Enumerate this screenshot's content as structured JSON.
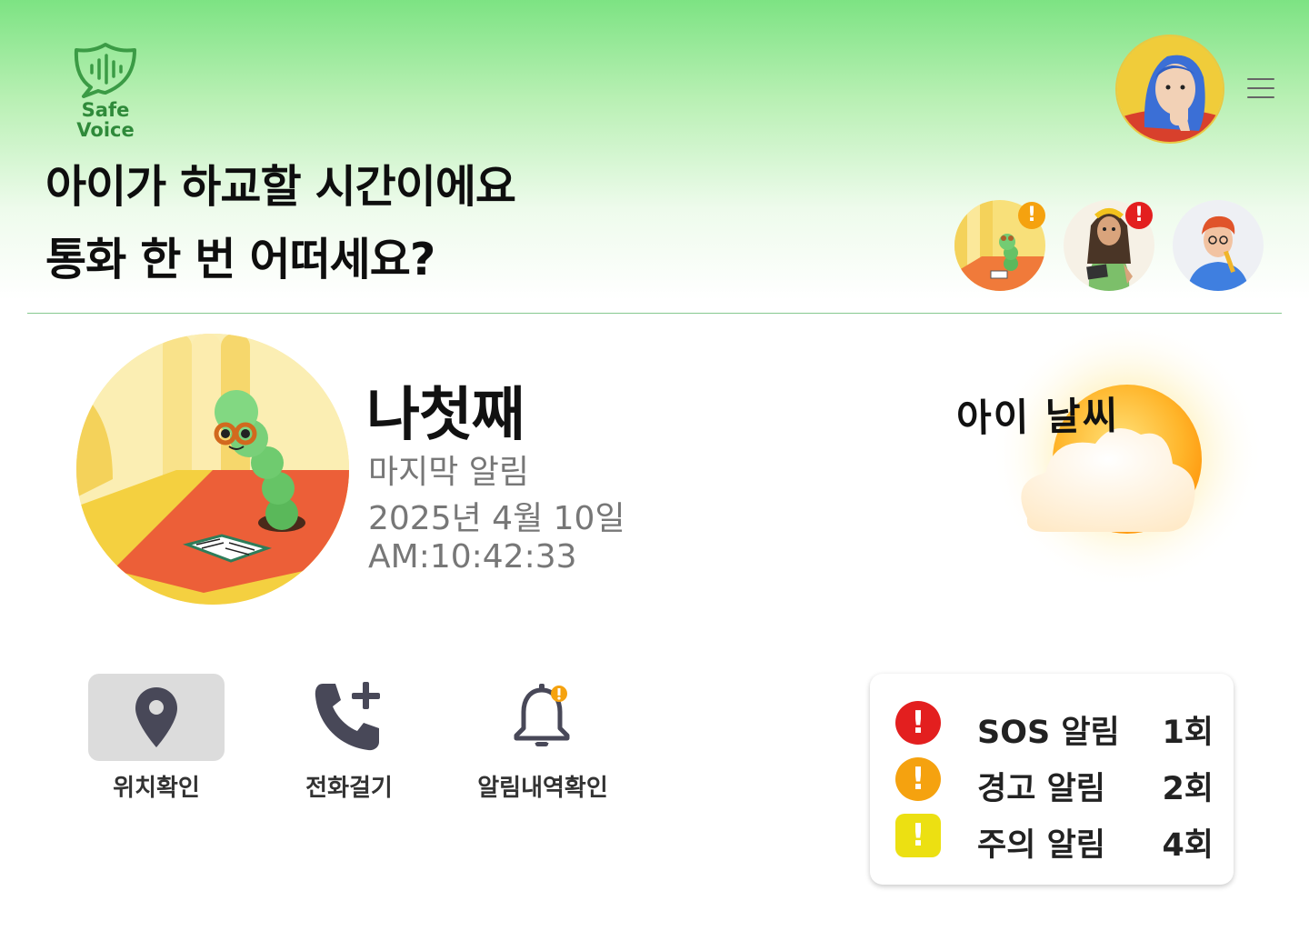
{
  "brand": {
    "line1": "Safe",
    "line2": "Voice",
    "color": "#2f8a3a"
  },
  "headline": {
    "line1": "아이가 하교할 시간이에요",
    "line2": "통화 한 번 어떠세요?"
  },
  "header": {
    "menu_icon": "hamburger-menu-icon",
    "profile_avatar": "user-avatar"
  },
  "children": [
    {
      "avatar": "caterpillar-avatar",
      "badge": "!",
      "badge_color": "#f5a20f"
    },
    {
      "avatar": "girl-laptop-avatar",
      "badge": "!",
      "badge_color": "#e31f1f"
    },
    {
      "avatar": "boy-pencil-avatar"
    }
  ],
  "selected_child": {
    "name": "나첫째",
    "last_alert_label": "마지막 알림",
    "date": "2025년 4월 10일",
    "time": "AM:10:42:33"
  },
  "weather": {
    "label": "아이 날씨",
    "icon": "sun-behind-cloud-icon"
  },
  "actions": [
    {
      "label": "위치확인",
      "icon": "location-pin-icon",
      "active": true
    },
    {
      "label": "전화걸기",
      "icon": "phone-add-icon",
      "active": false
    },
    {
      "label": "알림내역확인",
      "icon": "bell-alert-icon",
      "active": false
    }
  ],
  "alerts": [
    {
      "label": "SOS 알림",
      "count": "1회",
      "color": "#e31f1f",
      "icon": "exclamation-circle-icon"
    },
    {
      "label": "경고 알림",
      "count": "2회",
      "color": "#f5a20f",
      "icon": "exclamation-circle-icon"
    },
    {
      "label": "주의 알림",
      "count": "4회",
      "color": "#ece012",
      "icon": "exclamation-square-icon"
    }
  ]
}
